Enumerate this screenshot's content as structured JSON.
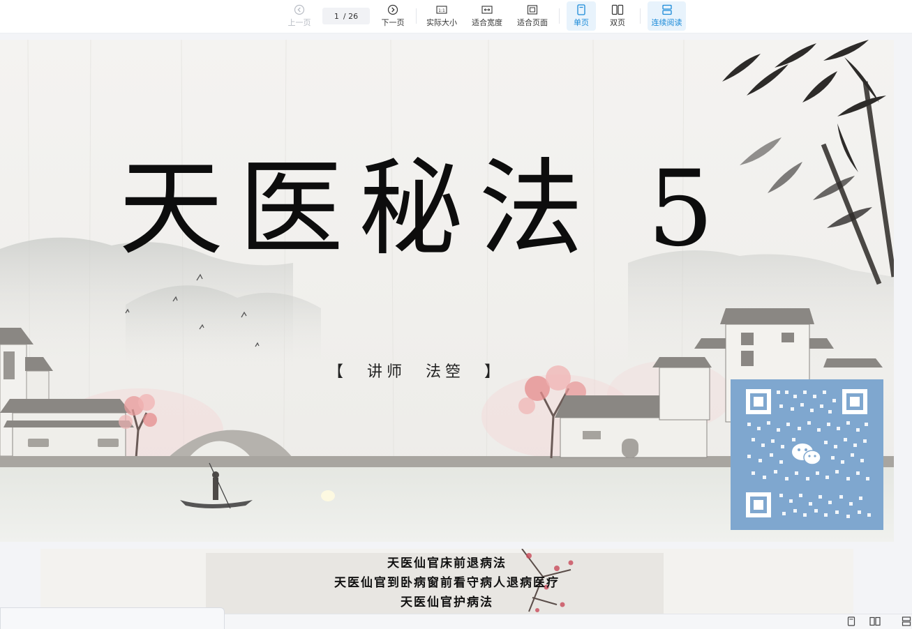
{
  "toolbar": {
    "prev_label": "上一页",
    "next_label": "下一页",
    "current_page": "1",
    "total_pages": "/ 26",
    "actual_size_label": "实际大小",
    "fit_width_label": "适合宽度",
    "fit_page_label": "适合页面",
    "single_page_label": "单页",
    "double_page_label": "双页",
    "continuous_label": "连续阅读",
    "accent_color": "#1a8ad8"
  },
  "slide1": {
    "title": "天医秘法 5",
    "lecturer": "【　讲师　法箜　】"
  },
  "slide2": {
    "lines": [
      "天医仙官床前退病法",
      "天医仙官到卧病窗前看守病人退病医疗",
      "天医仙官护病法"
    ]
  }
}
